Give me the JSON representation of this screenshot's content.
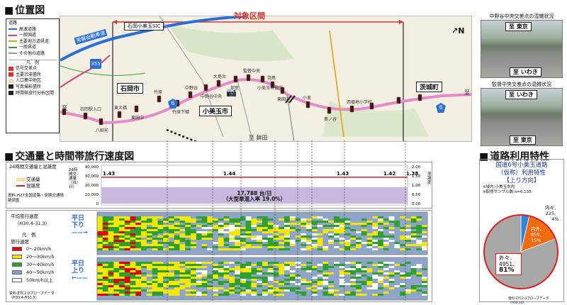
{
  "location": {
    "title": "位置図",
    "target_section": "対象区間",
    "legend": {
      "road_title": "道路",
      "roads": [
        {
          "label": "高速道路",
          "color": "#2b6fd6"
        },
        {
          "label": "一般国道",
          "color": "#e0407a"
        },
        {
          "label": "主要地方道県道",
          "color": "#e0a000"
        },
        {
          "label": "一般県道",
          "color": "#33a040"
        },
        {
          "label": "その他の道路",
          "color": "#999999"
        }
      ],
      "marker_title": "凡　例",
      "markers": [
        "信号交差点",
        "主要渋滞箇所",
        "人口集中地区",
        "写真撮影箇所",
        "時間帯旅行分析区間"
      ]
    },
    "labels": {
      "ic": "石岡小美玉SIC",
      "expressway": "常磐自動車道",
      "city_ishioka": "石岡市",
      "city_omitama": "小美玉市",
      "town_ibaraki": "茨城町",
      "route_6_a": "6",
      "route_6_b": "6",
      "route_355": "355",
      "to_west": "至",
      "to_south": "至 鉾田",
      "to_east": "至",
      "north": "N"
    },
    "intersections": [
      "石岡駅入口",
      "八軒前",
      "東大橋",
      "東田中",
      "竹原",
      "竹原下郷",
      "中野谷",
      "中野谷中央",
      "大島台",
      "部室",
      "監督中央",
      "小美玉市役所",
      "羽鳥",
      "東田中",
      "小美",
      "奥ノ谷",
      "西郷地小学校"
    ]
  },
  "traffic": {
    "title": "交通量と時間帯旅行速度図",
    "volume_label": "24時間交通量と混雑度",
    "vol_legend": [
      "交通量",
      "混雑度"
    ],
    "vol_source": "資料:H27全国道路・街路交通情勢調査",
    "axis_left_title": "24時間交通量（台/日）",
    "axis_right_title": "混雑度",
    "left_ticks": [
      "40,000",
      "30,000",
      "20,000",
      "10,000",
      "0"
    ],
    "right_ticks": [
      "2.00",
      "1.50",
      "1.00",
      "0.50",
      "0.00"
    ],
    "congestion_values": [
      "1.43",
      "1.44",
      "1.43",
      "1.42",
      "1.38"
    ],
    "volume_text": "17,788 台/日",
    "heavy_text": "（大型車混入率 19.0%）",
    "speed_label": "平均旅行速度",
    "speed_period": "（H30.4-31.3）",
    "speed_legend_title": "凡　例",
    "speed_legend_sub": "旅行速度",
    "speed_legend": [
      {
        "label": "0〜20km/h",
        "color": "#e00000"
      },
      {
        "label": "20〜30km/h",
        "color": "#f4e800"
      },
      {
        "label": "30〜40km/h",
        "color": "#2ea02e"
      },
      {
        "label": "40〜50km/h",
        "color": "#8ea4c8"
      },
      {
        "label": "50km/h以上",
        "color": "#ffffff"
      }
    ],
    "speed_source": "資料:ETC2.0プローブデータ（H30.4-H31.3）",
    "weekday": "平日",
    "down": "下り",
    "up": "上り"
  },
  "photos": {
    "photo1_title": "中野谷中央交差点の混雑状況",
    "photo1_top": "至 東京",
    "photo1_bottom": "至 いわき",
    "photo2_title": "監督中央交差点の混雑状況",
    "photo2_top": "至 いわき",
    "photo2_bottom": "至 東京"
  },
  "usage": {
    "title": "道路利用特性",
    "heading1": "国道6号小美玉道路",
    "heading2": "（仮称）利用特性",
    "heading3": "【上り方向】",
    "note1": "※域内:小美玉市内",
    "note2": "※取得サンプル数:n=6,135",
    "inner_label": "内々、",
    "inner_value": "225、",
    "inner_pct": "4%",
    "inout_label": "内外、",
    "inout_value": "959、",
    "inout_pct": "15%",
    "outer_label": "外々、",
    "outer_value": "4951、",
    "outer_pct": "81%",
    "source": "資料:ETC2.0プローブデータ（H30.10）",
    "pie": [
      {
        "name": "内々",
        "value": 225,
        "color": "#2f86d8"
      },
      {
        "name": "内外",
        "value": 959,
        "color": "#f06a10"
      },
      {
        "name": "外々",
        "value": 4951,
        "color": "#a8a8a8"
      }
    ]
  }
}
